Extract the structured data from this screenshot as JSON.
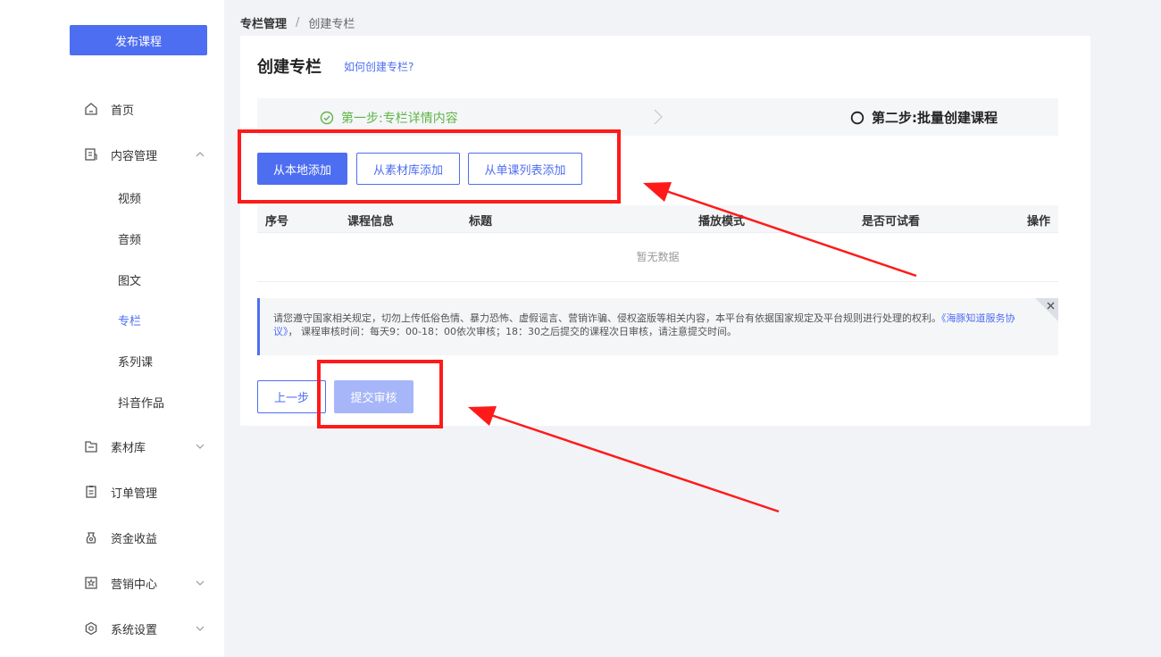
{
  "sidebar": {
    "publish_label": "发布课程",
    "items": [
      {
        "label": "首页",
        "icon": "home-icon"
      },
      {
        "label": "内容管理",
        "icon": "content-icon"
      },
      {
        "label": "素材库",
        "icon": "folder-icon"
      },
      {
        "label": "订单管理",
        "icon": "order-icon"
      },
      {
        "label": "资金收益",
        "icon": "money-icon"
      },
      {
        "label": "营销中心",
        "icon": "marketing-icon"
      },
      {
        "label": "系统设置",
        "icon": "settings-icon"
      }
    ],
    "content_sub": [
      {
        "label": "视频"
      },
      {
        "label": "音频"
      },
      {
        "label": "图文"
      },
      {
        "label": "专栏",
        "active": true
      },
      {
        "label": "系列课"
      },
      {
        "label": "抖音作品"
      }
    ]
  },
  "breadcrumb": {
    "root": "专栏管理",
    "separator": "/",
    "current": "创建专栏"
  },
  "page": {
    "title": "创建专栏",
    "help_link": "如何创建专栏?"
  },
  "steps": {
    "step1": "第一步:专栏详情内容",
    "step2": "第二步:批量创建课程"
  },
  "add_buttons": {
    "local": "从本地添加",
    "library": "从素材库添加",
    "course_list": "从单课列表添加"
  },
  "table": {
    "headers": [
      "序号",
      "课程信息",
      "标题",
      "播放模式",
      "是否可试看",
      "操作"
    ],
    "empty_text": "暂无数据"
  },
  "notice": {
    "text": "请您遵守国家相关规定，切勿上传低俗色情、暴力恐怖、虚假谣言、营销诈骗、侵权盗版等相关内容，本平台有依据国家规定及平台规则进行处理的权利。",
    "link": "《海豚知道服务协议》",
    "text2": "， 课程审核时间：每天9：00-18：00依次审核；18：30之后提交的课程次日审核，请注意提交时间。"
  },
  "footer": {
    "prev": "上一步",
    "submit": "提交审核"
  },
  "colors": {
    "primary": "#4e6ef2",
    "success": "#5fb547",
    "annotation": "#ff1a1a",
    "disabled": "#a6b6f8"
  }
}
